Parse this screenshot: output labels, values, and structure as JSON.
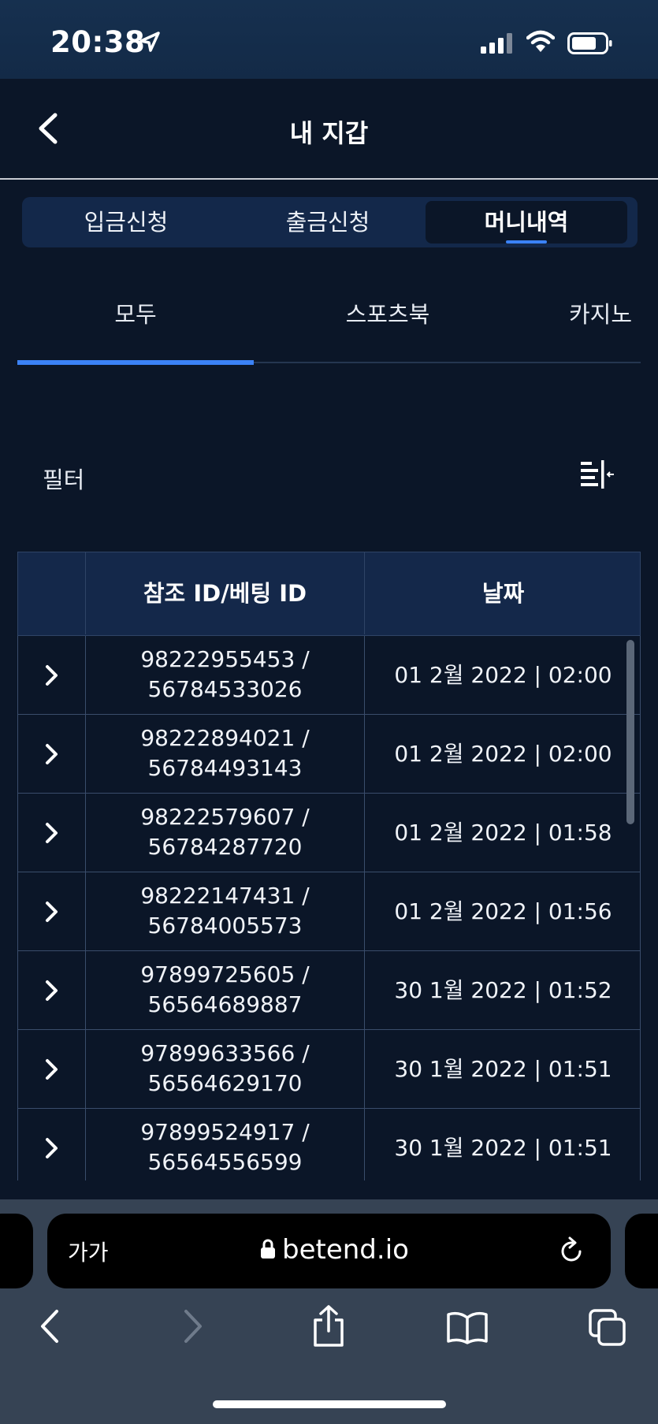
{
  "status_bar": {
    "time": "20:38"
  },
  "header": {
    "title": "내 지갑"
  },
  "segment_tabs": [
    {
      "label": "입금신청",
      "active": false
    },
    {
      "label": "출금신청",
      "active": false
    },
    {
      "label": "머니내역",
      "active": true
    }
  ],
  "sub_tabs": [
    {
      "label": "모두",
      "active": true
    },
    {
      "label": "스포츠북",
      "active": false
    },
    {
      "label": "카지노",
      "active": false
    }
  ],
  "filter": {
    "label": "필터"
  },
  "table": {
    "columns": [
      "",
      "참조 ID/베팅 ID",
      "날짜"
    ],
    "rows": [
      {
        "ref_id": "98222955453 /",
        "bet_id": "56784533026",
        "date": "01 2월 2022 | 02:00"
      },
      {
        "ref_id": "98222894021 /",
        "bet_id": "56784493143",
        "date": "01 2월 2022 | 02:00"
      },
      {
        "ref_id": "98222579607 /",
        "bet_id": "56784287720",
        "date": "01 2월 2022 | 01:58"
      },
      {
        "ref_id": "98222147431 /",
        "bet_id": "56784005573",
        "date": "01 2월 2022 | 01:56"
      },
      {
        "ref_id": "97899725605 /",
        "bet_id": "56564689887",
        "date": "30 1월 2022 | 01:52"
      },
      {
        "ref_id": "97899633566 /",
        "bet_id": "56564629170",
        "date": "30 1월 2022 | 01:51"
      },
      {
        "ref_id": "97899524917 /",
        "bet_id": "56564556599",
        "date": "30 1월 2022 | 01:51"
      }
    ]
  },
  "browser": {
    "text_size_label": "가가",
    "url": "betend.io"
  },
  "colors": {
    "accent": "#3b82f6",
    "background": "#0b1628",
    "header_bg": "#14284a"
  }
}
